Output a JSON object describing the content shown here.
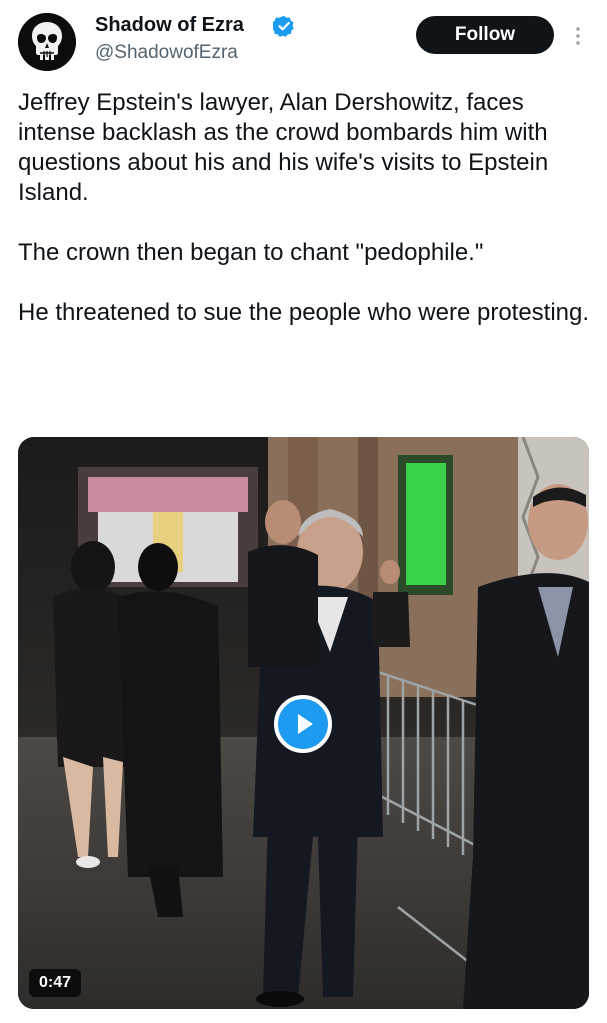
{
  "author": {
    "display_name": "Shadow of Ezra",
    "handle": "@ShadowofEzra",
    "verified": true,
    "avatar_icon": "skull-logo"
  },
  "actions": {
    "follow_label": "Follow",
    "more_icon": "vertical-ellipsis-icon"
  },
  "tweet": {
    "paragraphs": [
      "Jeffrey Epstein's lawyer, Alan Dershowitz, faces intense backlash as the crowd bombards him with questions about his and his wife's visits to Epstein Island.",
      "The crown then began to chant \"pedophile.\"",
      "He threatened to sue the people who were protesting."
    ]
  },
  "media": {
    "type": "video",
    "duration": "0:47",
    "play_icon": "play-icon"
  },
  "colors": {
    "accent": "#1d9bf0",
    "text": "#0f1419",
    "secondary_text": "#536471",
    "button_bg": "#0f1419"
  }
}
